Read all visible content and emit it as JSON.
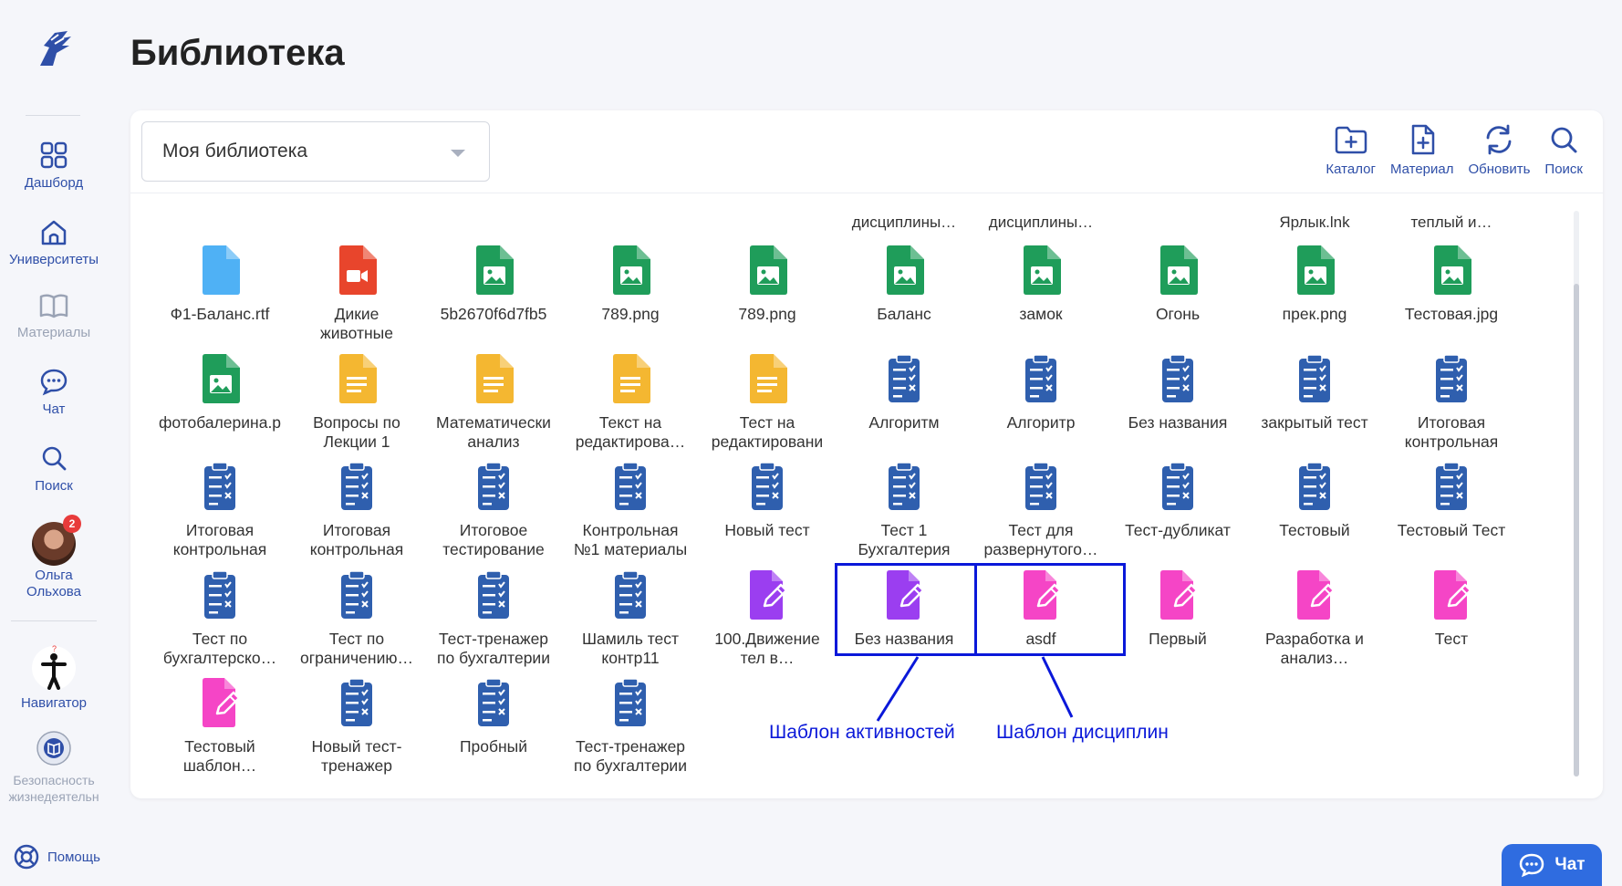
{
  "page": {
    "title": "Библиотека"
  },
  "sidebar": {
    "items": [
      {
        "label": "Дашборд",
        "icon": "grid-icon"
      },
      {
        "label": "Университеты",
        "icon": "university-icon"
      },
      {
        "label": "Материалы",
        "icon": "book-icon"
      },
      {
        "label": "Чат",
        "icon": "chat-icon"
      },
      {
        "label": "Поиск",
        "icon": "search-icon"
      }
    ],
    "user": {
      "name_line1": "Ольга",
      "name_line2": "Ольхова",
      "badge": "2"
    },
    "navigator": {
      "label": "Навигатор"
    },
    "course": {
      "label_line1": "Безопасность",
      "label_line2": "жизнедеятельн"
    },
    "help": {
      "label": "Помощь"
    }
  },
  "library": {
    "select_value": "Моя библиотека",
    "toolbar": [
      {
        "label": "Каталог",
        "icon": "folder-plus-icon"
      },
      {
        "label": "Материал",
        "icon": "file-plus-icon"
      },
      {
        "label": "Обновить",
        "icon": "refresh-icon"
      },
      {
        "label": "Поиск",
        "icon": "search-icon"
      }
    ],
    "partial_row": [
      "дисциплины…",
      "дисциплины…",
      "Ярлык.lnk",
      "теплый и…"
    ],
    "rows": [
      [
        {
          "type": "rtf",
          "name": [
            "Ф1-Баланс.rtf"
          ]
        },
        {
          "type": "video",
          "name": [
            "Дикие",
            "животные"
          ]
        },
        {
          "type": "image",
          "name": [
            "5b2670f6d7fb5"
          ]
        },
        {
          "type": "image",
          "name": [
            "789.png"
          ]
        },
        {
          "type": "image",
          "name": [
            "789.png"
          ]
        },
        {
          "type": "image",
          "name": [
            "Баланс"
          ]
        },
        {
          "type": "image",
          "name": [
            "замок"
          ]
        },
        {
          "type": "image",
          "name": [
            "Огонь"
          ]
        },
        {
          "type": "image",
          "name": [
            "прек.png"
          ]
        },
        {
          "type": "image",
          "name": [
            "Тестовая.jpg"
          ]
        }
      ],
      [
        {
          "type": "image",
          "name": [
            "фотобалерина.p"
          ]
        },
        {
          "type": "doc",
          "name": [
            "Вопросы по",
            "Лекции 1"
          ]
        },
        {
          "type": "doc",
          "name": [
            "Математически",
            "анализ"
          ]
        },
        {
          "type": "doc",
          "name": [
            "Текст на",
            "редактирова…"
          ]
        },
        {
          "type": "doc",
          "name": [
            "Тест на",
            "редактировани"
          ]
        },
        {
          "type": "test",
          "name": [
            "Алгоритм"
          ]
        },
        {
          "type": "test",
          "name": [
            "Алгоритр"
          ]
        },
        {
          "type": "test",
          "name": [
            "Без названия"
          ]
        },
        {
          "type": "test",
          "name": [
            "закрытый тест"
          ]
        },
        {
          "type": "test",
          "name": [
            "Итоговая",
            "контрольная"
          ]
        }
      ],
      [
        {
          "type": "test",
          "name": [
            "Итоговая",
            "контрольная"
          ]
        },
        {
          "type": "test",
          "name": [
            "Итоговая",
            "контрольная"
          ]
        },
        {
          "type": "test",
          "name": [
            "Итоговое",
            "тестирование"
          ]
        },
        {
          "type": "test",
          "name": [
            "Контрольная",
            "№1 материалы"
          ]
        },
        {
          "type": "test",
          "name": [
            "Новый тест"
          ]
        },
        {
          "type": "test",
          "name": [
            "Тест 1",
            "Бухгалтерия"
          ]
        },
        {
          "type": "test",
          "name": [
            "Тест для",
            "развернутого…"
          ]
        },
        {
          "type": "test",
          "name": [
            "Тест-дубликат"
          ]
        },
        {
          "type": "test",
          "name": [
            "Тестовый"
          ]
        },
        {
          "type": "test",
          "name": [
            "Тестовый Тест"
          ]
        }
      ],
      [
        {
          "type": "test",
          "name": [
            "Тест по",
            "бухгалтерско…"
          ]
        },
        {
          "type": "test",
          "name": [
            "Тест по",
            "ограничению…"
          ]
        },
        {
          "type": "test",
          "name": [
            "Тест-тренажер",
            "по бухгалтерии"
          ]
        },
        {
          "type": "test",
          "name": [
            "Шамиль тест",
            "контр11"
          ]
        },
        {
          "type": "edit-purple",
          "name": [
            "100.Движение",
            "тел в…"
          ]
        },
        {
          "type": "edit-purple",
          "name": [
            "Без названия"
          ]
        },
        {
          "type": "edit-pink",
          "name": [
            "asdf"
          ]
        },
        {
          "type": "edit-pink",
          "name": [
            "Первый"
          ]
        },
        {
          "type": "edit-pink",
          "name": [
            "Разработка и",
            "анализ…"
          ]
        },
        {
          "type": "edit-pink",
          "name": [
            "Тест"
          ]
        }
      ],
      [
        {
          "type": "edit-pink",
          "name": [
            "Тестовый",
            "шаблон…"
          ]
        },
        {
          "type": "test",
          "name": [
            "Новый тест-",
            "тренажер"
          ]
        },
        {
          "type": "test",
          "name": [
            "Пробный"
          ]
        },
        {
          "type": "test",
          "name": [
            "Тест-тренажер",
            "по бухгалтерии"
          ]
        }
      ]
    ]
  },
  "annotations": {
    "activity_template": "Шаблон активностей",
    "discipline_template": "Шаблон дисциплин",
    "color": "#0a18d9"
  },
  "chat_button": {
    "label": "Чат"
  },
  "colors": {
    "accent": "#2f4fa8",
    "image_file": "#1f9d5a",
    "doc_file": "#f4b731",
    "test_file": "#2f5fae",
    "video_file": "#e8452c",
    "rtf_file": "#4fb1f5",
    "edit_purple": "#9b3ef0",
    "edit_pink": "#f545c6"
  }
}
